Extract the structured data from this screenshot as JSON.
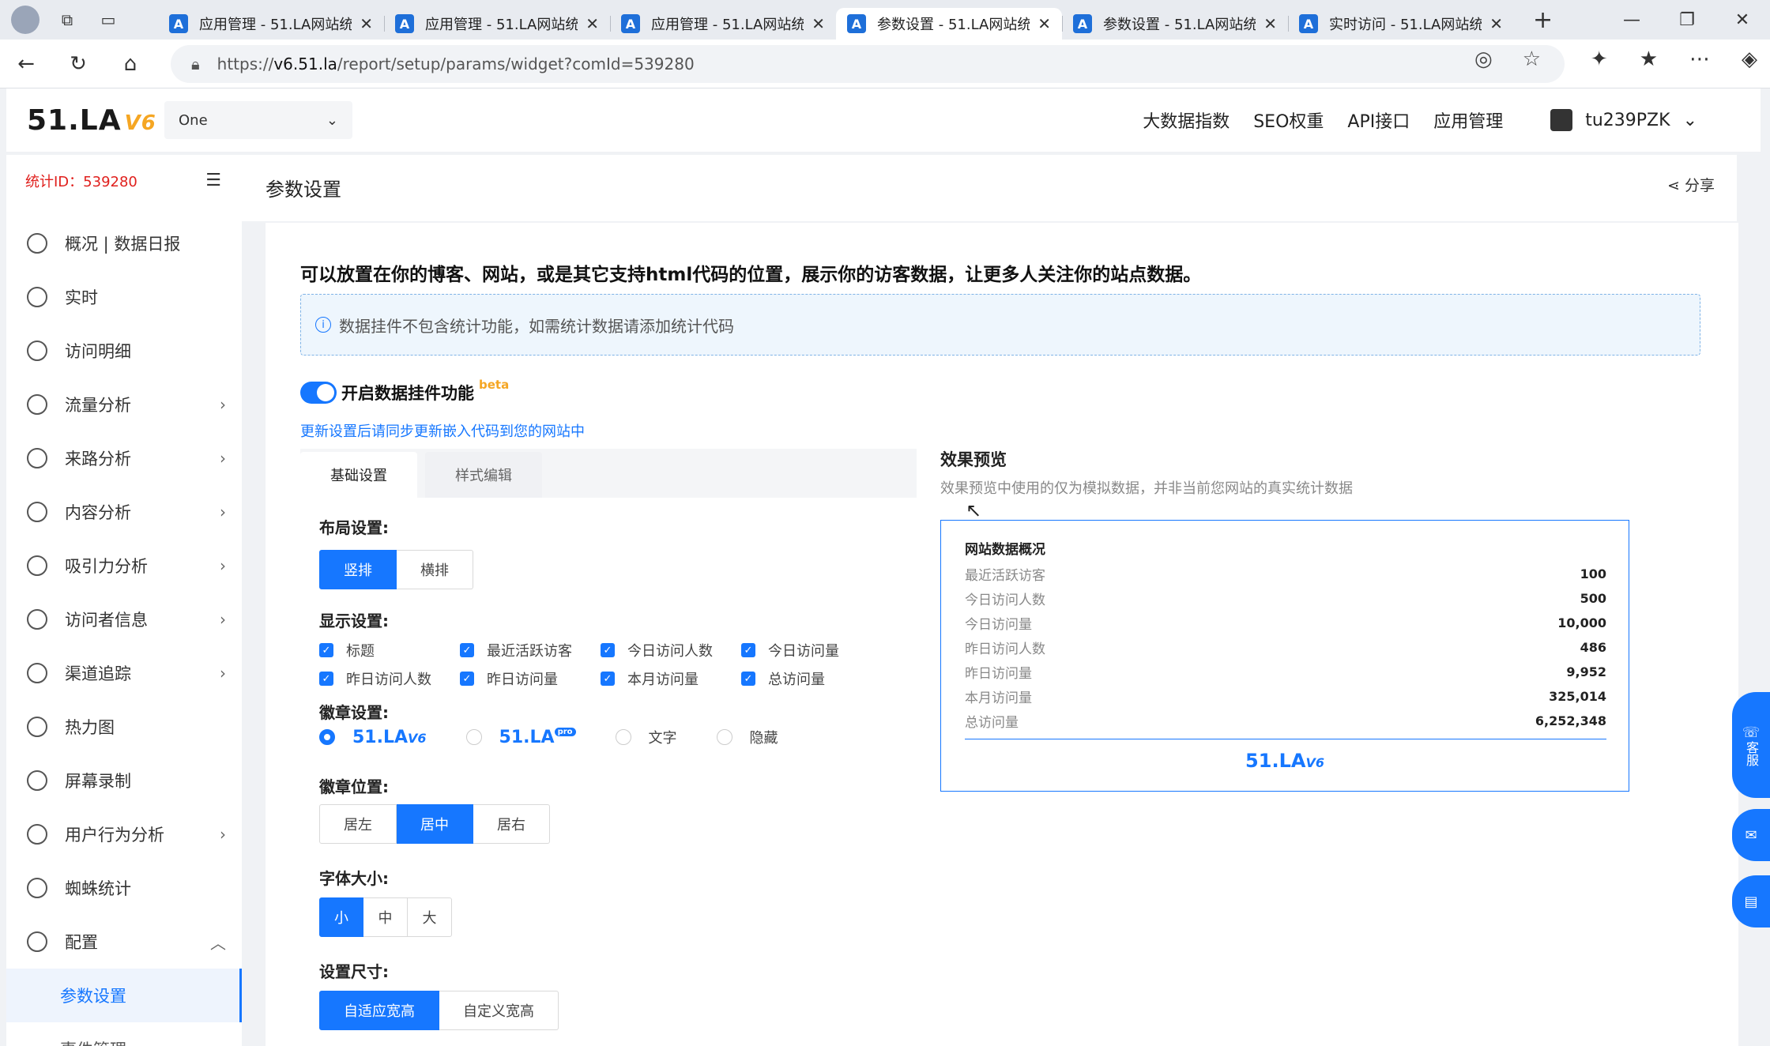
{
  "browser": {
    "tabs": [
      {
        "title": "应用管理 - 51.LA网站统计",
        "active": false
      },
      {
        "title": "应用管理 - 51.LA网站统计",
        "active": false
      },
      {
        "title": "应用管理 - 51.LA网站统计",
        "active": false
      },
      {
        "title": "参数设置 - 51.LA网站统计",
        "active": true
      },
      {
        "title": "参数设置 - 51.LA网站统计",
        "active": false
      },
      {
        "title": "实时访问 - 51.LA网站统计",
        "active": false
      }
    ],
    "url_prefix": "https://",
    "url_host": "v6.51.la",
    "url_path": "/report/setup/params/widget?comId=539280"
  },
  "header": {
    "logo": "51.LA",
    "logo_version": "V6",
    "site_select": "One",
    "nav": [
      "大数据指数",
      "SEO权重",
      "API接口",
      "应用管理"
    ],
    "username": "tu239PZK"
  },
  "sidebar": {
    "stat_id": "统计ID：539280",
    "items": [
      {
        "label": "概况 | 数据日报",
        "icon": "dashboard-icon",
        "arrow": false
      },
      {
        "label": "实时",
        "icon": "clock-icon",
        "arrow": false
      },
      {
        "label": "访问明细",
        "icon": "list-search-icon",
        "arrow": false
      },
      {
        "label": "流量分析",
        "icon": "pulse-icon",
        "arrow": true
      },
      {
        "label": "来路分析",
        "icon": "source-icon",
        "arrow": true
      },
      {
        "label": "内容分析",
        "icon": "document-icon",
        "arrow": true
      },
      {
        "label": "吸引力分析",
        "icon": "pie-icon",
        "arrow": true
      },
      {
        "label": "访问者信息",
        "icon": "mail-icon",
        "arrow": true
      },
      {
        "label": "渠道追踪",
        "icon": "target-icon",
        "arrow": true
      },
      {
        "label": "热力图",
        "icon": "heatmap-icon",
        "arrow": false
      },
      {
        "label": "屏幕录制",
        "icon": "record-icon",
        "arrow": false
      },
      {
        "label": "用户行为分析",
        "icon": "users-icon",
        "arrow": true
      },
      {
        "label": "蜘蛛统计",
        "icon": "spider-icon",
        "arrow": false
      },
      {
        "label": "配置",
        "icon": "gear-icon",
        "arrow": true
      }
    ],
    "sub_items": [
      "参数设置",
      "事件管理"
    ]
  },
  "page": {
    "title": "参数设置",
    "share": "分享",
    "intro": "可以放置在你的博客、网站，或是其它支持html代码的位置，展示你的访客数据，让更多人关注你的站点数据。",
    "notice": "数据挂件不包含统计功能，如需统计数据请添加统计代码",
    "toggle_label": "开启数据挂件功能",
    "beta": "beta",
    "update_link": "更新设置后请同步更新嵌入代码到您的网站中",
    "tabs": [
      "基础设置",
      "样式编辑"
    ]
  },
  "form": {
    "layout": {
      "title": "布局设置:",
      "options": [
        "竖排",
        "横排"
      ],
      "selected": "竖排"
    },
    "display": {
      "title": "显示设置:",
      "options": [
        "标题",
        "最近活跃访客",
        "今日访问人数",
        "今日访问量",
        "昨日访问人数",
        "昨日访问量",
        "本月访问量",
        "总访问量"
      ]
    },
    "badge": {
      "title": "徽章设置:",
      "options": [
        "51.LA V6",
        "51.LA pro",
        "文字",
        "隐藏"
      ],
      "selected": "51.LA V6"
    },
    "badge_pos": {
      "title": "徽章位置:",
      "options": [
        "居左",
        "居中",
        "居右"
      ],
      "selected": "居中"
    },
    "font_size": {
      "title": "字体大小:",
      "options": [
        "小",
        "中",
        "大"
      ],
      "selected": "小"
    },
    "size": {
      "title": "设置尺寸:",
      "options": [
        "自适应宽高",
        "自定义宽高"
      ],
      "selected": "自适应宽高"
    }
  },
  "preview": {
    "title": "效果预览",
    "subtitle": "效果预览中使用的仅为模拟数据，并非当前您网站的真实统计数据",
    "card_title": "网站数据概况",
    "rows": [
      {
        "label": "最近活跃访客",
        "value": "100"
      },
      {
        "label": "今日访问人数",
        "value": "500"
      },
      {
        "label": "今日访问量",
        "value": "10,000"
      },
      {
        "label": "昨日访问人数",
        "value": "486"
      },
      {
        "label": "昨日访问量",
        "value": "9,952"
      },
      {
        "label": "本月访问量",
        "value": "325,014"
      },
      {
        "label": "总访问量",
        "value": "6,252,348"
      }
    ],
    "logo": "51.LA",
    "logo_version": "V6"
  },
  "floaters": {
    "service": "客服"
  },
  "colors": {
    "accent": "#1677ff",
    "stat_id": "#e0201d",
    "beta": "#f5a623"
  }
}
